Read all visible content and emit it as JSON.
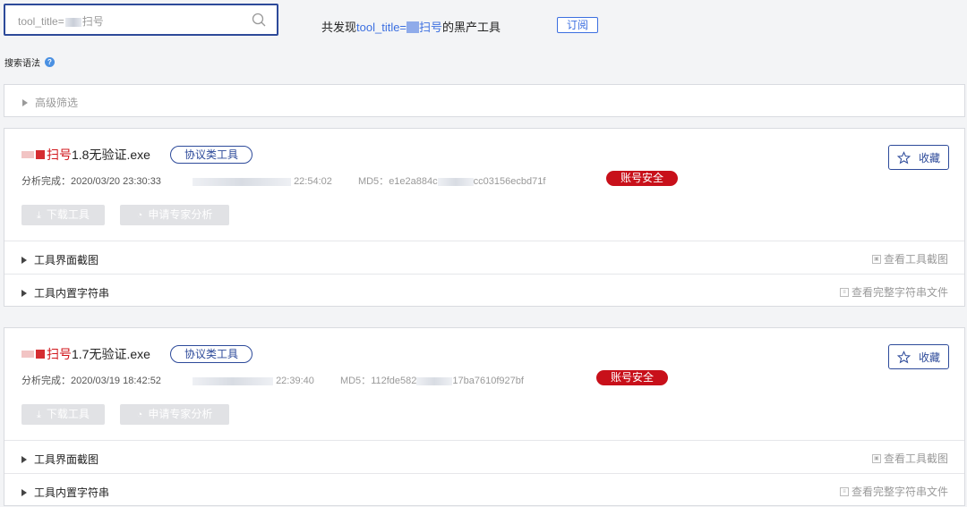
{
  "search": {
    "query_prefix": "tool_title=",
    "query_suffix": "扫号"
  },
  "summary": {
    "prefix": "共发现",
    "query_prefix": "tool_title=",
    "query_suffix": "扫号",
    "suffix": "的黑产工具",
    "subscribe_label": "订阅"
  },
  "syntax_label": "搜索语法",
  "advanced_filter_label": "高级筛选",
  "results": [
    {
      "title_red": "扫号",
      "title_rest": "1.8无验证.exe",
      "tag": "协议类工具",
      "analysis_label": "分析完成：",
      "analysis_time": "2020/03/20 23:30:33",
      "time2": "22:54:02",
      "md5_label": "MD5：",
      "md5_start": "e1e2a884c",
      "md5_end": "cc03156ecbd71f",
      "badge": "账号安全",
      "collect_label": "收藏",
      "download_label": "下载工具",
      "expert_label": "申请专家分析",
      "screenshot_section": "工具界面截图",
      "screenshot_link": "查看工具截图",
      "strings_section": "工具内置字符串",
      "strings_link": "查看完整字符串文件"
    },
    {
      "title_red": "扫号",
      "title_rest": "1.7无验证.exe",
      "tag": "协议类工具",
      "analysis_label": "分析完成：",
      "analysis_time": "2020/03/19 18:42:52",
      "time2": "22:39:40",
      "md5_label": "MD5：",
      "md5_start": "112fde582",
      "md5_end": "17ba7610f927bf",
      "badge": "账号安全",
      "collect_label": "收藏",
      "download_label": "下载工具",
      "expert_label": "申请专家分析",
      "screenshot_section": "工具界面截图",
      "screenshot_link": "查看工具截图",
      "strings_section": "工具内置字符串",
      "strings_link": "查看完整字符串文件"
    }
  ]
}
